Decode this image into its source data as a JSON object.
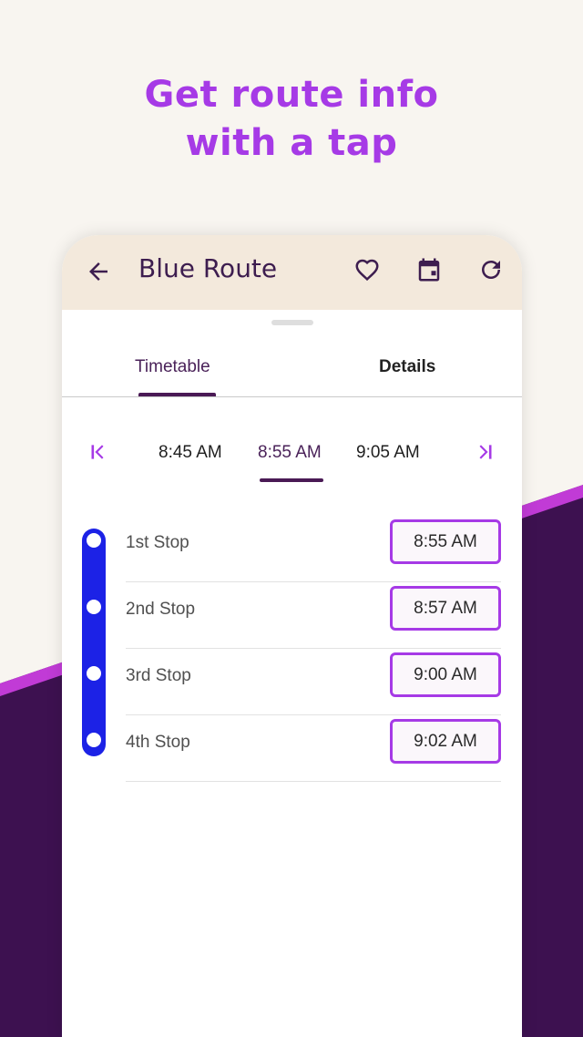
{
  "promo": {
    "line1": "Get route info",
    "line2": "with a tap"
  },
  "colors": {
    "accent": "#a63ae6",
    "dark_purple": "#3d1150",
    "pink_stripe": "#c13bd6",
    "route_blue": "#1c22e6",
    "appbar_bg": "#f3e9dc",
    "background": "#f8f5f0"
  },
  "appbar": {
    "back_icon": "arrow-left-icon",
    "title": "Blue Route",
    "favorite_icon": "heart-outline-icon",
    "calendar_icon": "calendar-icon",
    "refresh_icon": "refresh-icon"
  },
  "tabs": [
    {
      "label": "Timetable",
      "selected": true
    },
    {
      "label": "Details",
      "selected": false
    }
  ],
  "times": {
    "first_icon": "skip-first-icon",
    "last_icon": "skip-last-icon",
    "items": [
      {
        "label": "8:45 AM",
        "selected": false
      },
      {
        "label": "8:55 AM",
        "selected": true
      },
      {
        "label": "9:05 AM",
        "selected": false
      }
    ]
  },
  "stops": [
    {
      "name": "1st Stop",
      "time": "8:55 AM"
    },
    {
      "name": "2nd Stop",
      "time": "8:57 AM"
    },
    {
      "name": "3rd Stop",
      "time": "9:00 AM"
    },
    {
      "name": "4th Stop",
      "time": "9:02 AM"
    }
  ]
}
